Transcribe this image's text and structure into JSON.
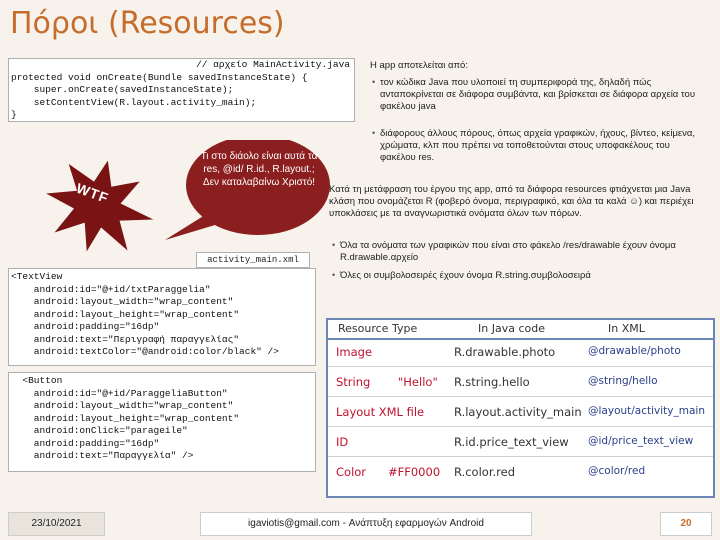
{
  "title": "Πόροι (Resources)",
  "code1": {
    "filename": "// αρχείο MainActivity.java",
    "lines": [
      "protected void onCreate(Bundle savedInstanceState) {",
      "    super.onCreate(savedInstanceState);",
      "    setContentView(R.layout.activity_main);",
      "}"
    ]
  },
  "code2_filename": "activity_main.xml",
  "code2_lines": [
    "<TextView",
    "    android:id=\"@+id/txtParaggelia\"",
    "    android:layout_width=\"wrap_content\"",
    "    android:layout_height=\"wrap_content\"",
    "    android:padding=\"16dp\"",
    "    android:text=\"Περιγραφή παραγγελίας\"",
    "    android:textColor=\"@android:color/black\" />"
  ],
  "code3_lines": [
    "  <Button",
    "    android:id=\"@+id/ParaggeliaButton\"",
    "    android:layout_width=\"wrap_content\"",
    "    android:layout_height=\"wrap_content\"",
    "    android:onClick=\"parageile\"",
    "    android:padding=\"16dp\"",
    "    android:text=\"Παραγγελία\" />"
  ],
  "wtf": "WTF",
  "bubble": "Τι στο διάολο είναι αυτά τα res, @id/ R.id., R.layout.; Δεν καταλαβαίνω Χριστό!",
  "right": {
    "intro": "Η app αποτελείται από:",
    "b1": "τον κώδικα Java που υλοποιεί τη συμπεριφορά της, δηλαδή πώς ανταποκρίνεται σε διάφορα συμβάντα, και βρίσκεται σε διάφορα αρχεία του φακέλου java",
    "b2": "διάφορους άλλους πόρους, όπως αρχεία γραφικών, ήχους, βίντεο, κείμενα, χρώματα, κλπ που πρέπει να τοποθετούνται στους υποφακέλους του φακέλου res.",
    "p2": "Κατά τη μετάφραση του έργου της app, από τα διάφορα resources φτιάχνεται μια Java κλάση που ονομάζεται R (φοβερό όνομα, περιγραφικό, και όλα τα καλά ☺) και περιέχει υποκλάσεις με τα αναγνωριστικά ονόματα όλων των πόρων.",
    "b3": "Όλα τα ονόματα των γραφικών που είναι στο φάκελο /res/drawable έχουν όνομα R.drawable.αρχείο",
    "b4": "Όλες οι συμβολοσειρές έχουν όνομα R.string.συμβολοσειρά"
  },
  "table": {
    "headers": [
      "Resource Type",
      "In Java code",
      "In XML"
    ],
    "rows": [
      [
        "Image",
        "R.drawable.photo",
        "@drawable/photo"
      ],
      [
        "String",
        "R.string.hello",
        "@string/hello"
      ],
      [
        "Layout XML file",
        "R.layout.activity_main",
        "@layout/activity_main"
      ],
      [
        "ID",
        "R.id.price_text_view",
        "@id/price_text_view"
      ],
      [
        "Color",
        "R.color.red",
        "@color/red"
      ]
    ],
    "string_note": "\"Hello\"",
    "color_note": "#FF0000"
  },
  "footer": {
    "date": "23/10/2021",
    "center": "igaviotis@gmail.com - Ανάπτυξη εφαρμογών Android",
    "page": "20"
  }
}
